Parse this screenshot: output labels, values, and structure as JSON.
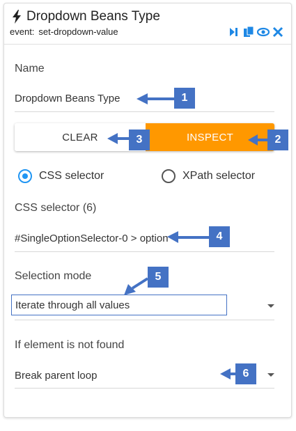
{
  "header": {
    "title": "Dropdown Beans Type",
    "event_label": "event:",
    "event_value": "set-dropdown-value"
  },
  "name_section": {
    "label": "Name",
    "value": "Dropdown Beans Type"
  },
  "buttons": {
    "clear_label": "CLEAR",
    "inspect_label": "INSPECT"
  },
  "selector_type": {
    "css_label": "CSS selector",
    "xpath_label": "XPath selector",
    "selected": "CSS selector"
  },
  "css_selector": {
    "label": "CSS selector (6)",
    "value": "#SingleOptionSelector-0 > option"
  },
  "selection_mode": {
    "label": "Selection mode",
    "value": "Iterate through all values"
  },
  "not_found": {
    "label": "If element is not found",
    "value": "Break parent loop"
  },
  "callouts": [
    "1",
    "2",
    "3",
    "4",
    "5",
    "6"
  ],
  "colors": {
    "accent_orange": "#ff9800",
    "radio_blue": "#2196f3",
    "callout_blue": "#4472c4"
  }
}
